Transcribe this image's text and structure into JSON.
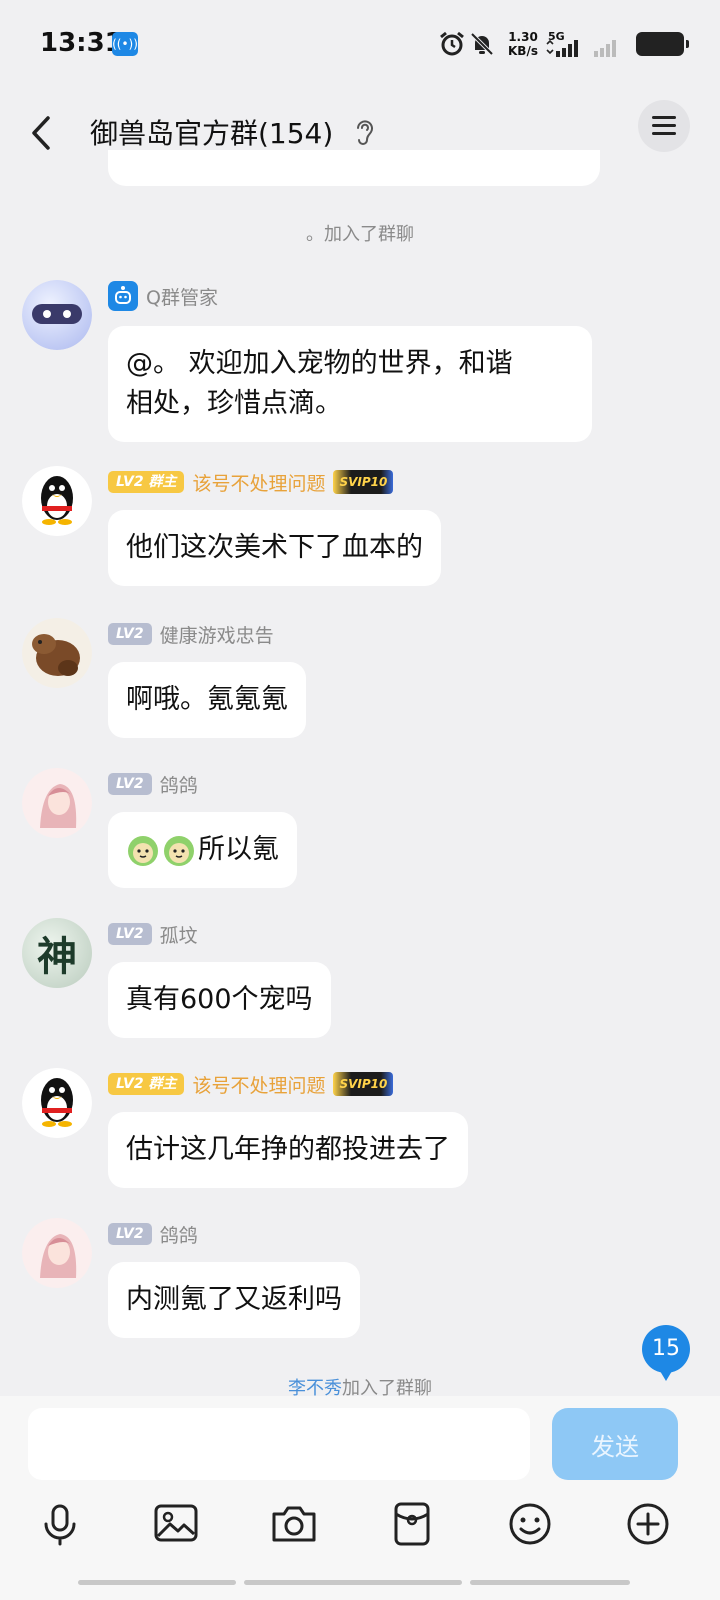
{
  "status_bar": {
    "time": "13:31",
    "net_speed_value": "1.30",
    "net_speed_unit": "KB/s",
    "network": "5G"
  },
  "header": {
    "title": "御兽岛官方群(154)"
  },
  "system_messages": {
    "joined_top": "。加入了群聊",
    "joined_bottom_name": "李不秀",
    "joined_bottom_text": "加入了群聊"
  },
  "messages": [
    {
      "sender": "Q群管家",
      "text_line1": "@。 欢迎加入宠物的世界，和谐",
      "text_line2": "相处，珍惜点滴。"
    },
    {
      "level": "LV2",
      "role": "群主",
      "sender": "该号不处理问题",
      "vip": "SVIP10",
      "text": "他们这次美术下了血本的"
    },
    {
      "level": "LV2",
      "sender": "健康游戏忠告",
      "text": "啊哦。氪氪氪"
    },
    {
      "level": "LV2",
      "sender": "鸽鸽",
      "text": "所以氪"
    },
    {
      "level": "LV2",
      "sender": "孤坟",
      "avatar_char": "神",
      "text": "真有600个宠吗"
    },
    {
      "level": "LV2",
      "role": "群主",
      "sender": "该号不处理问题",
      "vip": "SVIP10",
      "text": "估计这几年挣的都投进去了"
    },
    {
      "level": "LV2",
      "sender": "鸽鸽",
      "text": "内测氪了又返利吗"
    }
  ],
  "unread_count": "15",
  "input": {
    "placeholder": "",
    "send_label": "发送"
  },
  "colors": {
    "accent": "#1e88e5",
    "level_badge": "#b7bdd0",
    "owner_badge": "#f7c843",
    "owner_name": "#e8a23a"
  }
}
